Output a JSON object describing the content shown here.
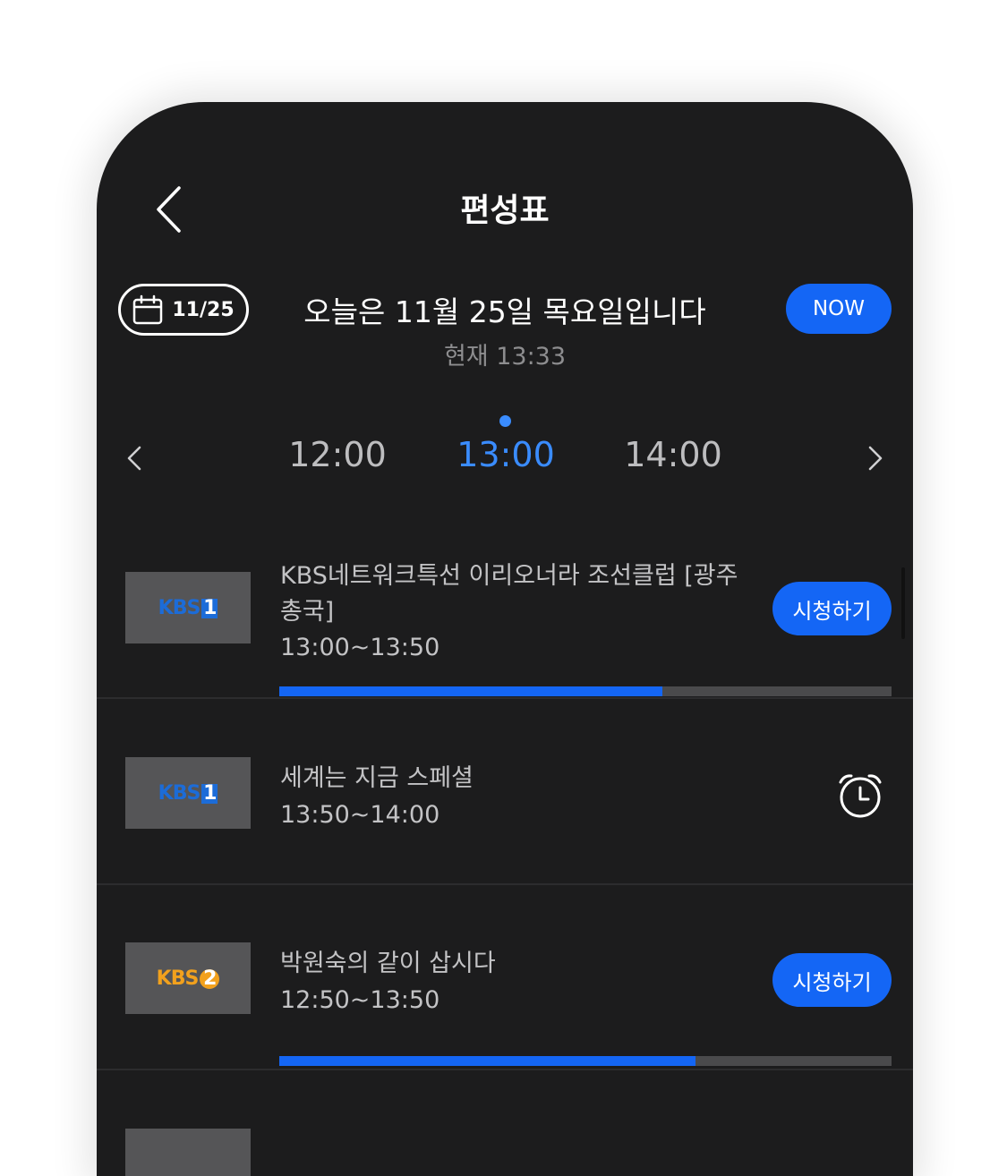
{
  "header": {
    "title": "편성표"
  },
  "date_bar": {
    "date_label": "11/25",
    "today_text": "오늘은 11월 25일 목요일입니다",
    "current_time_text": "현재 13:33",
    "now_label": "NOW"
  },
  "timeline": {
    "slots": [
      "12:00",
      "13:00",
      "14:00"
    ],
    "active_slot": "13:00"
  },
  "programs": [
    {
      "channel": "KBS1",
      "title": "KBS네트워크특선 이리오너라 조선클럽 [광주총국]",
      "time": "13:00~13:50",
      "action_label": "시청하기",
      "progress": 0.625
    },
    {
      "channel": "KBS1",
      "title": "세계는 지금 스페셜",
      "time": "13:50~14:00",
      "action": "alarm-icon"
    },
    {
      "channel": "KBS2",
      "title": "박원숙의 같이 삽시다",
      "time": "12:50~13:50",
      "action_label": "시청하기",
      "progress": 0.68
    }
  ],
  "colors": {
    "background": "#1c1c1d",
    "accent": "#1466f5",
    "active_time": "#3a8cff",
    "kbs1": "#1c6cd8",
    "kbs2": "#f2a11d"
  }
}
